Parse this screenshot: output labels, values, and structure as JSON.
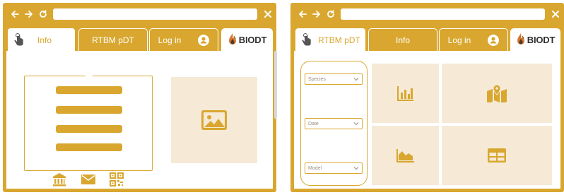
{
  "colors": {
    "accent": "#d9a72f",
    "panel": "#f6ead6",
    "white": "#ffffff"
  },
  "left_window": {
    "tabs": [
      {
        "label": "Info",
        "active": true
      },
      {
        "label": "RTBM pDT",
        "active": false
      },
      {
        "label": "Log in",
        "active": false
      }
    ],
    "logo": "BIODT",
    "menu_items": [
      "menu-line",
      "menu-line",
      "menu-line",
      "menu-line"
    ],
    "footer_icons": [
      "bank-icon",
      "mail-icon",
      "qr-code-icon"
    ]
  },
  "right_window": {
    "tabs": [
      {
        "label": "RTBM pDT",
        "active": true
      },
      {
        "label": "Info",
        "active": false
      },
      {
        "label": "Log in",
        "active": false
      }
    ],
    "logo": "BIODT",
    "selects": [
      {
        "placeholder": "Species"
      },
      {
        "placeholder": "Date"
      },
      {
        "placeholder": "Model"
      }
    ],
    "grid_icons": [
      "bar-chart-icon",
      "map-icon",
      "area-chart-icon",
      "table-icon"
    ]
  }
}
